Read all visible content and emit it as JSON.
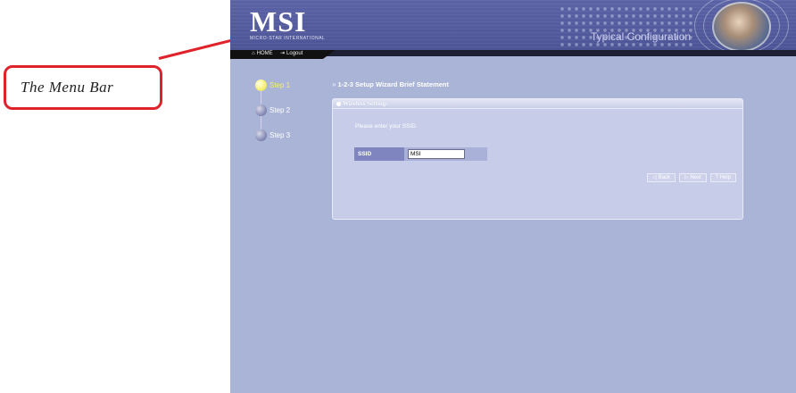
{
  "callout": {
    "text": "The Menu Bar",
    "color": "#e0222a"
  },
  "header": {
    "logo": "MSI",
    "logo_subtitle": "MICRO-STAR INTERNATIONAL",
    "page_title": "Typical Configuration"
  },
  "menu": {
    "items": [
      {
        "label": "HOME",
        "icon": "home-icon",
        "icon_glyph": "⌂"
      },
      {
        "label": "Logout",
        "icon": "logout-icon",
        "icon_glyph": "⇥"
      }
    ]
  },
  "steps": [
    {
      "label": "Step 1",
      "active": true
    },
    {
      "label": "Step 2",
      "active": false
    },
    {
      "label": "Step 3",
      "active": false
    }
  ],
  "wizard": {
    "title_icon": "»",
    "title": "1-2-3 Setup Wizard Brief Statement"
  },
  "panel": {
    "title": "Wireless Settings",
    "prompt": "Please enter your SSID.",
    "ssid_label": "SSID",
    "ssid_value": "MSI"
  },
  "buttons": {
    "back": "◁ Back",
    "next": "▷ Next",
    "help": "? Help"
  },
  "colors": {
    "header": "#5b63a6",
    "background": "#aab4d6",
    "active_step": "#f6f17a"
  }
}
